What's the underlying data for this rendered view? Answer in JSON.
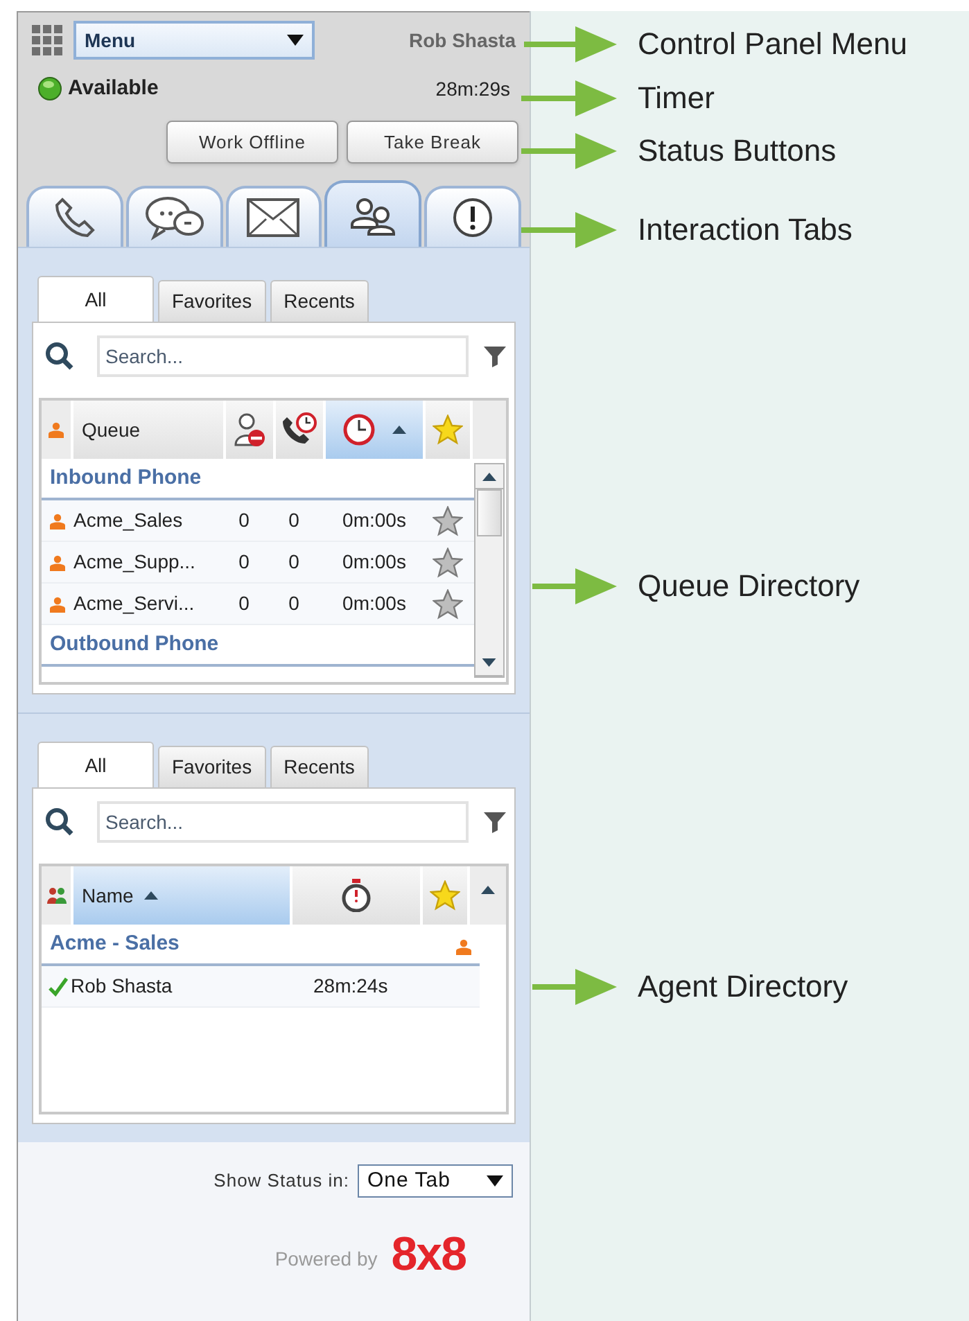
{
  "header": {
    "menu": "Menu",
    "user": "Rob Shasta",
    "status": "Available",
    "available": true,
    "timer": "28m:29s"
  },
  "status_buttons": [
    "Work Offline",
    "Take Break"
  ],
  "interaction_tabs": [
    {
      "kind": "phone",
      "selected": false
    },
    {
      "kind": "chat",
      "selected": false
    },
    {
      "kind": "email",
      "selected": false
    },
    {
      "kind": "directory",
      "selected": true
    },
    {
      "kind": "alert",
      "selected": false
    }
  ],
  "queue_directory": {
    "tabs": [
      {
        "label": "All",
        "selected": true
      },
      {
        "label": "Favorites",
        "selected": false
      },
      {
        "label": "Recents",
        "selected": false
      }
    ],
    "search": {
      "placeholder": "Search..."
    },
    "columns": [
      {
        "kind": "queue",
        "label": "Queue",
        "sorted": false
      },
      {
        "kind": "unavailable",
        "sorted": false
      },
      {
        "kind": "waiting",
        "sorted": false
      },
      {
        "kind": "wait-time",
        "sorted": true
      },
      {
        "kind": "favorite",
        "sorted": false
      }
    ],
    "groups": [
      {
        "name": "Inbound Phone",
        "rows": [
          {
            "name": "Acme_Sales",
            "column_2": "0",
            "column_3": "0",
            "column_4": "0m:00s",
            "favorite": false
          },
          {
            "name": "Acme_Supp...",
            "column_2": "0",
            "column_3": "0",
            "column_4": "0m:00s",
            "favorite": false
          },
          {
            "name": "Acme_Servi...",
            "column_2": "0",
            "column_3": "0",
            "column_4": "0m:00s",
            "favorite": false
          }
        ]
      },
      {
        "name": "Outbound Phone"
      }
    ]
  },
  "agent_directory": {
    "tabs": [
      {
        "label": "All",
        "selected": true
      },
      {
        "label": "Favorites",
        "selected": false
      },
      {
        "label": "Recents",
        "selected": false
      }
    ],
    "search": {
      "placeholder": "Search..."
    },
    "columns": [
      {
        "kind": "name",
        "label": "Name",
        "sorted": true
      },
      {
        "kind": "duration",
        "sorted": false
      },
      {
        "kind": "favorite",
        "sorted": false
      }
    ],
    "groups": [
      {
        "name": "Acme - Sales",
        "rows": [
          {
            "name": "Rob Shasta",
            "available": true,
            "time": "28m:24s"
          }
        ]
      }
    ]
  },
  "footer": {
    "show_status_label": "Show Status in:",
    "show_status_value": "One Tab",
    "powered_by": "Powered by",
    "logo": "8x8"
  },
  "annotations": [
    {
      "label": "Control Panel Menu"
    },
    {
      "label": "Timer"
    },
    {
      "label": "Status Buttons"
    },
    {
      "label": "Interaction Tabs"
    },
    {
      "label": "Queue Directory"
    },
    {
      "label": "Agent Directory"
    }
  ]
}
